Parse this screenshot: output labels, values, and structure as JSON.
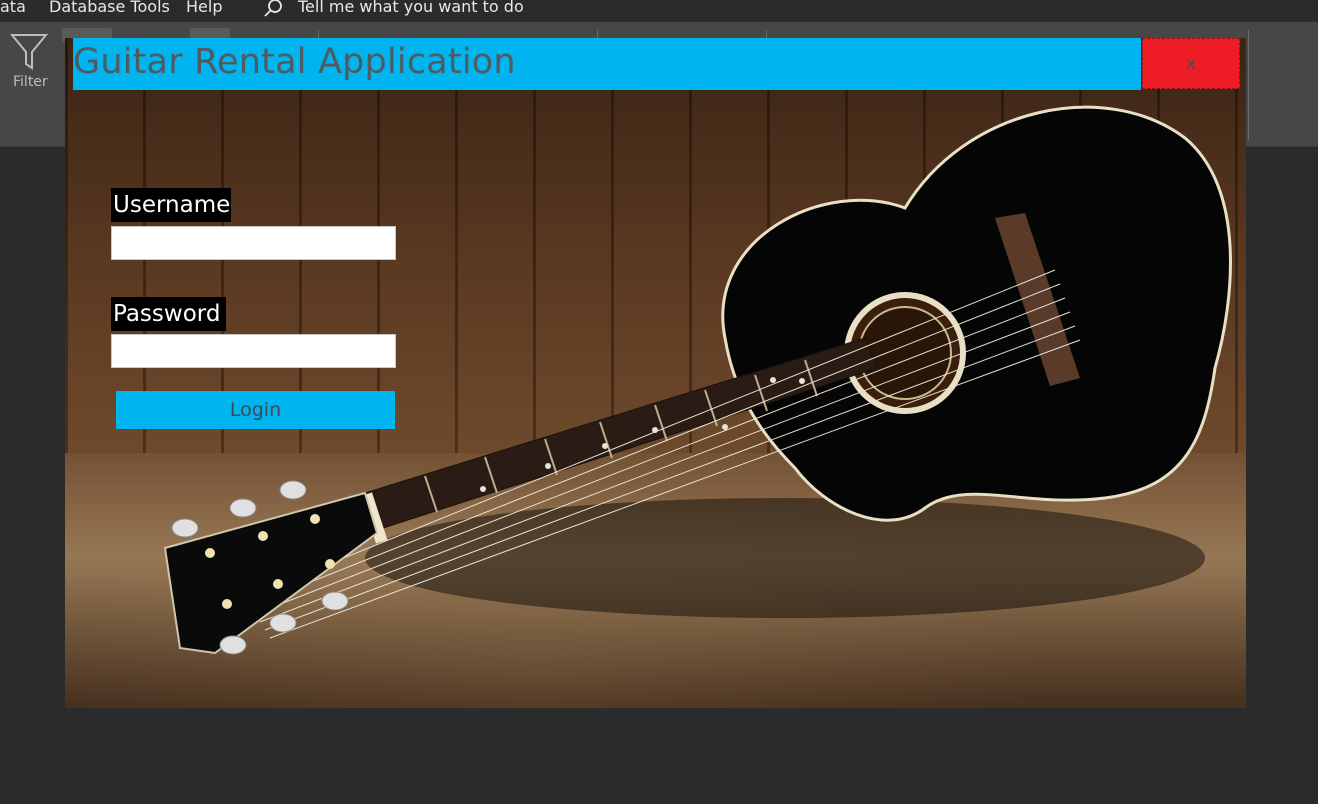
{
  "menubar": {
    "items": [
      "ata",
      "Database Tools",
      "Help"
    ],
    "tell_me": "Tell me what you want to do"
  },
  "ribbon": {
    "filter_label": "Filter"
  },
  "form": {
    "title": "Guitar Rental Application",
    "close_label": "x",
    "username_label": "Username",
    "username_value": "",
    "password_label": "Password",
    "password_value": "",
    "login_label": "Login"
  },
  "colors": {
    "accent": "#00b4ef",
    "close": "#ee1c25",
    "app_background": "#2b2b2b",
    "ribbon": "#474747"
  }
}
